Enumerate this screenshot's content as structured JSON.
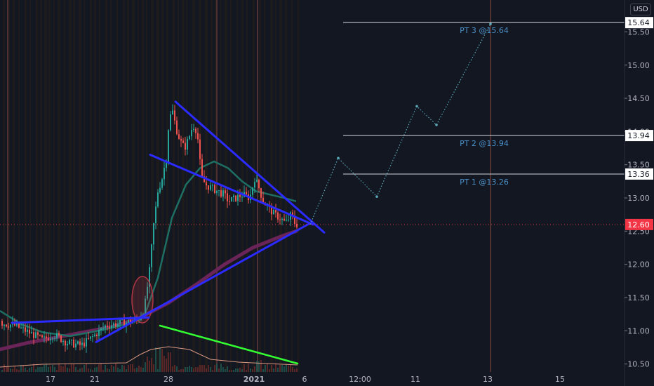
{
  "currency_button": "USD",
  "chart_data": {
    "type": "candlestick",
    "title": "",
    "xlabel": "",
    "ylabel": "",
    "ylim": [
      10.38,
      15.98
    ],
    "y_ticks": [
      10.5,
      11.0,
      11.5,
      12.0,
      12.5,
      13.0,
      13.5,
      14.0,
      14.5,
      15.0,
      15.5
    ],
    "y_tick_labels": [
      "10.50",
      "11.00",
      "11.50",
      "12.00",
      "12.50",
      "13.00",
      "13.50",
      "14.00",
      "14.50",
      "15.00",
      "15.50"
    ],
    "x_tick_labels": [
      "17",
      "21",
      "28",
      "2021",
      "6",
      "12:00",
      "11",
      "13",
      "15"
    ],
    "grid": false,
    "current_price": {
      "value": 12.6,
      "label": "12.60",
      "color": "#f23645"
    },
    "price_targets": [
      {
        "value": 13.36,
        "tag": "13.36",
        "note": "PT 1 @13.26"
      },
      {
        "value": 13.94,
        "tag": "13.94",
        "note": "PT 2 @13.94"
      },
      {
        "value": 15.64,
        "tag": "15.64",
        "note": "PT 3 @15.64"
      }
    ],
    "colors": {
      "up": "#26a69a",
      "down": "#ef5350",
      "trendline": "#2b2bff",
      "volume_trend": "#33ff33",
      "ma_fast": "#1e6f63",
      "ma_slow": "#6b2458",
      "vwap": "#f2a98f",
      "projection": "#5ba8b8",
      "note_text": "#4a90c8"
    }
  }
}
